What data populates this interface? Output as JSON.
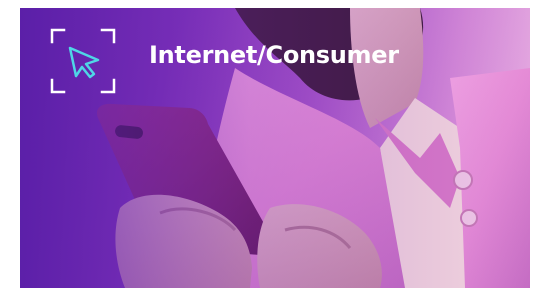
{
  "banner": {
    "title": "Internet/Consumer",
    "icon": "cursor-in-frame-icon",
    "photo": "person-holding-smartphone"
  },
  "colors": {
    "gradient_start": "#5b1fa8",
    "gradient_mid": "#a653c8",
    "gradient_end": "#e9b3e3",
    "shirt": "#e98fd8",
    "phone": "#7a1d6a",
    "title_text": "#ffffff",
    "icon_stroke": "#ffffff",
    "cursor_stroke": "#4fd6e6"
  }
}
